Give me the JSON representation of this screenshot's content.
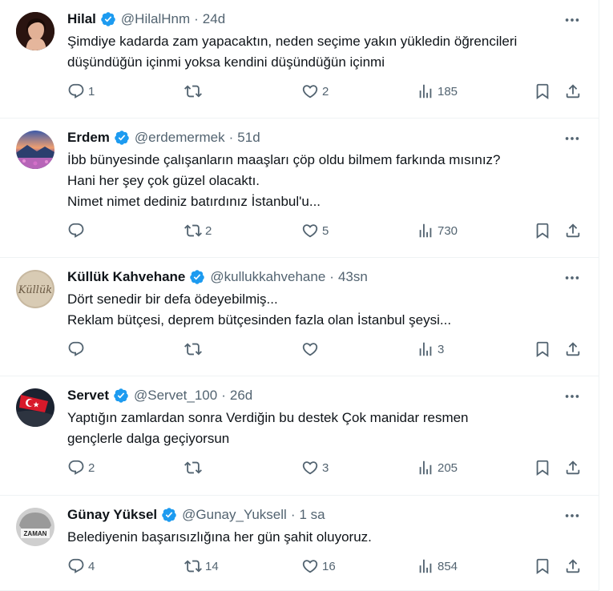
{
  "tweets": [
    {
      "name": "Hilal",
      "handle": "@HilalHnm",
      "time": "24d",
      "text": "Şimdiye kadarda zam yapacaktın, neden seçime yakın yükledin öğrencileri\ndüşündüğün içinmi yoksa  kendini düşündüğün içinmi",
      "replies": "1",
      "retweets": "",
      "likes": "2",
      "views": "185"
    },
    {
      "name": "Erdem",
      "handle": "@erdemermek",
      "time": "51d",
      "text": "İbb bünyesinde çalışanların maaşları çöp oldu bilmem farkında mısınız?\nHani her şey çok güzel olacaktı.\nNimet nimet dediniz batırdınız İstanbul'u...",
      "replies": "",
      "retweets": "2",
      "likes": "5",
      "views": "730"
    },
    {
      "name": "Küllük Kahvehane",
      "handle": "@kullukkahvehane",
      "time": "43sn",
      "text": "Dört senedir bir defa ödeyebilmiş...\nReklam bütçesi, deprem bütçesinden fazla olan İstanbul şeysi...",
      "replies": "",
      "retweets": "",
      "likes": "",
      "views": "3"
    },
    {
      "name": "Servet",
      "handle": "@Servet_100",
      "time": "26d",
      "text": "Yaptığın zamlardan sonra Verdiğin bu destek Çok manidar resmen\ngençlerle dalga geçiyorsun",
      "replies": "2",
      "retweets": "",
      "likes": "3",
      "views": "205"
    },
    {
      "name": "Günay Yüksel",
      "handle": "@Gunay_Yuksell",
      "time": "1 sa",
      "text": "Belediyenin başarısızlığına her gün şahit oluyoruz.",
      "replies": "4",
      "retweets": "14",
      "likes": "16",
      "views": "854"
    }
  ],
  "avatar_labels": {
    "kulluk": "Küllük",
    "zaman": "ZAMAN"
  },
  "colors": {
    "verified": "#1d9bf0",
    "secondary": "#536471",
    "divider": "#eff3f4"
  },
  "icons": [
    "reply-icon",
    "retweet-icon",
    "like-icon",
    "views-icon",
    "bookmark-icon",
    "share-icon",
    "more-icon",
    "verified-icon"
  ]
}
